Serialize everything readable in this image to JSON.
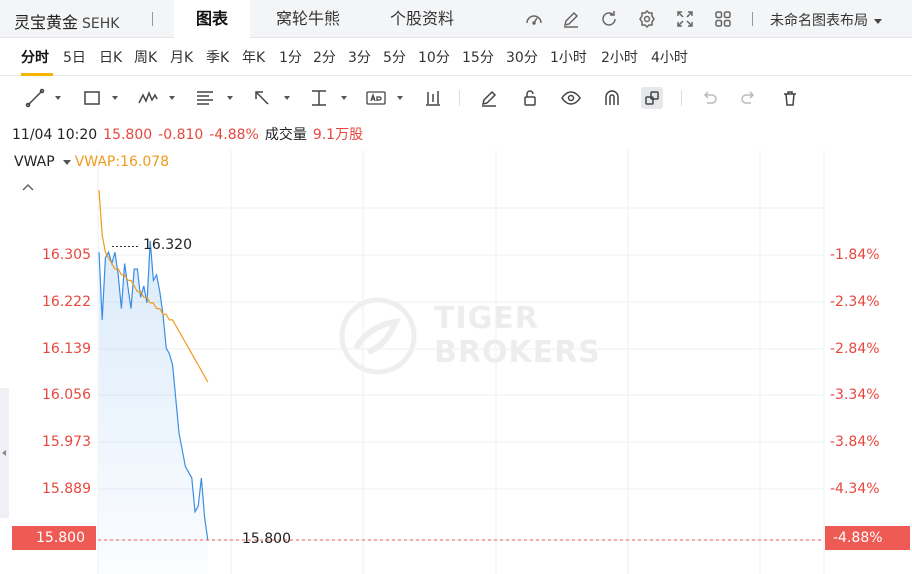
{
  "header": {
    "stock_name": "灵宝黄金",
    "stock_code": "SEHK",
    "tabs": [
      "图表",
      "窝轮牛熊",
      "个股资料"
    ],
    "active_tab": 0,
    "layout_label": "未命名图表布局"
  },
  "periods": [
    "分时",
    "5日",
    "日K",
    "周K",
    "月K",
    "季K",
    "年K",
    "1分",
    "2分",
    "3分",
    "5分",
    "10分",
    "15分",
    "30分",
    "1小时",
    "2小时",
    "4小时"
  ],
  "active_period": 0,
  "quote": {
    "time": "11/04 10:20",
    "price": "15.800",
    "change": "-0.810",
    "change_pct": "-4.88%",
    "volume_label": "成交量",
    "volume": "9.1万股"
  },
  "indicator": {
    "name": "VWAP",
    "value_text": "VWAP:16.078"
  },
  "y_axis_left": [
    "16.305",
    "16.222",
    "16.139",
    "16.056",
    "15.973",
    "15.889"
  ],
  "y_axis_right": [
    "-1.84%",
    "-2.34%",
    "-2.84%",
    "-3.34%",
    "-3.84%",
    "-4.34%"
  ],
  "last_price_tag": "15.800",
  "last_pct_tag": "-4.88%",
  "high_marker": "16.320",
  "last_marker": "15.800",
  "watermark": {
    "line1": "TIGER",
    "line2": "BROKERS"
  },
  "colors": {
    "up_down_red": "#e8473f",
    "price_line": "#3a8ee6",
    "vwap_line": "#f09a1a",
    "active_underline": "#f4b400"
  },
  "chart_data": {
    "type": "line",
    "ylim": [
      15.8,
      16.305
    ],
    "series": [
      {
        "name": "VWAP",
        "values": [
          16.42,
          16.34,
          16.31,
          16.3,
          16.29,
          16.28,
          16.28,
          16.27,
          16.27,
          16.26,
          16.26,
          16.25,
          16.24,
          16.24,
          16.23,
          16.23,
          16.22,
          16.22,
          16.21,
          16.21,
          16.2,
          16.2,
          16.19,
          16.19,
          16.18,
          16.17,
          16.16,
          16.15,
          16.14,
          16.13,
          16.12,
          16.11,
          16.1,
          16.09,
          16.08
        ]
      },
      {
        "values": [
          16.31,
          16.19,
          16.3,
          16.31,
          16.29,
          16.31,
          16.27,
          16.21,
          16.29,
          16.25,
          16.21,
          16.28,
          16.28,
          16.23,
          16.25,
          16.22,
          16.33,
          16.26,
          16.27,
          16.24,
          16.2,
          16.14,
          16.13,
          16.11,
          16.05,
          15.99,
          15.96,
          15.93,
          15.92,
          15.91,
          15.85,
          15.86,
          15.91,
          15.84,
          15.8
        ]
      }
    ]
  }
}
